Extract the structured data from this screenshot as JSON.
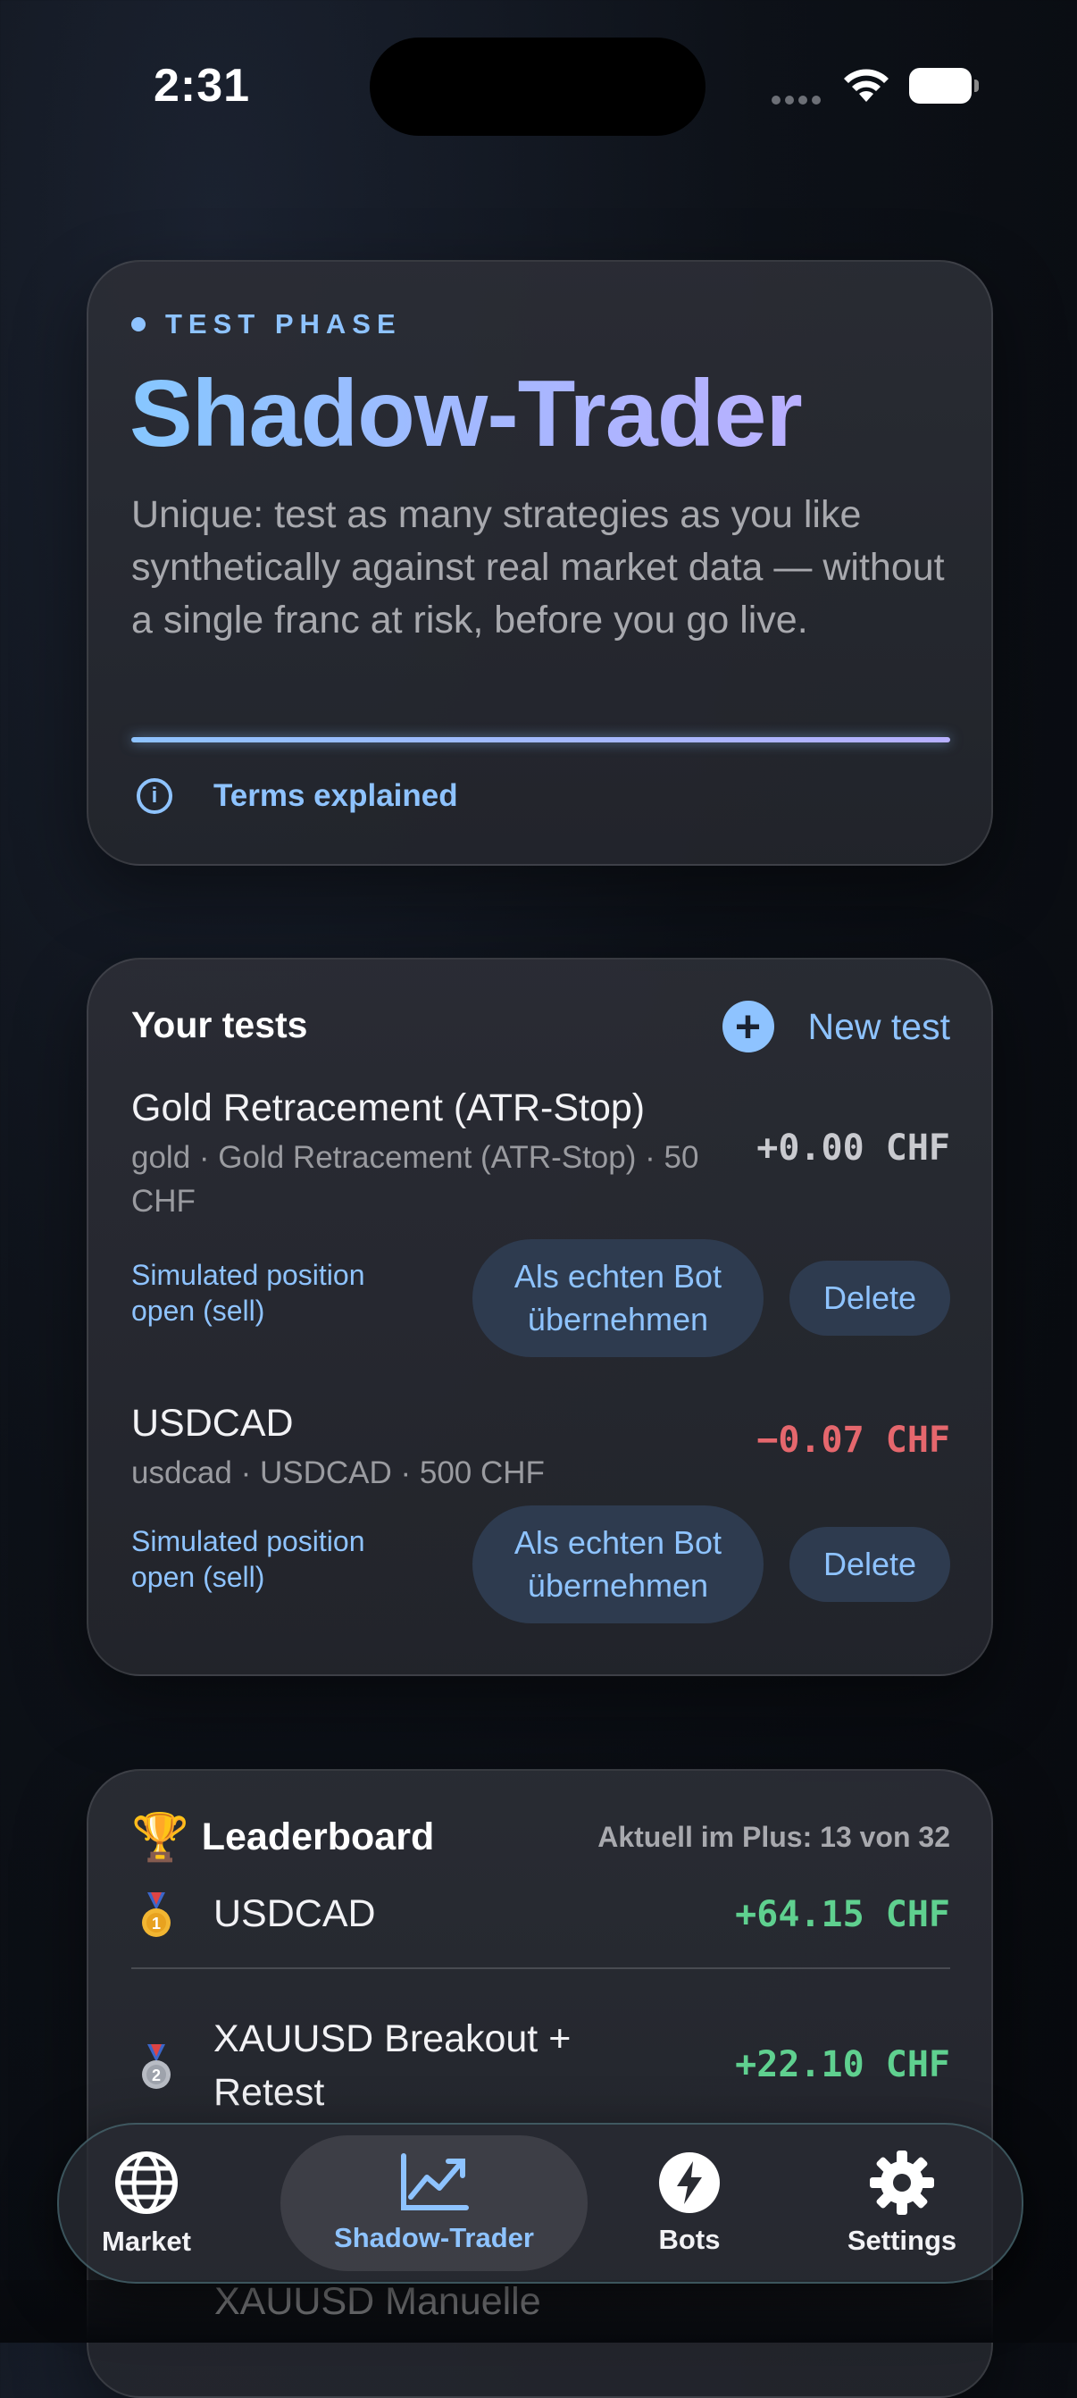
{
  "status_bar": {
    "time": "2:31"
  },
  "hero": {
    "badge": "TEST PHASE",
    "title": "Shadow-Trader",
    "description": "Unique: test as many strategies as you like synthetically against real market data — without a single franc at risk, before you go live.",
    "terms_link": "Terms explained"
  },
  "tests": {
    "heading": "Your tests",
    "new_test_label": "New test",
    "items": [
      {
        "name": "Gold Retracement (ATR-Stop)",
        "meta": "gold · Gold Retracement (ATR-Stop) · 50 CHF",
        "pnl": "+0.00 CHF",
        "pnl_color": "#c9cacf",
        "status": "Simulated position open (sell)",
        "adopt_label": "Als echten Bot übernehmen",
        "delete_label": "Delete"
      },
      {
        "name": "USDCAD",
        "meta": "usdcad · USDCAD · 500 CHF",
        "pnl": "−0.07 CHF",
        "pnl_color": "#e5676d",
        "status": "Simulated position open (sell)",
        "adopt_label": "Als echten Bot übernehmen",
        "delete_label": "Delete"
      }
    ]
  },
  "leaderboard": {
    "title": "Leaderboard",
    "summary": "Aktuell im Plus: 13 von 32",
    "rows": [
      {
        "medal": "gold-medal-icon",
        "name": "USDCAD",
        "value": "+64.15 CHF"
      },
      {
        "medal": "silver-medal-icon",
        "name": "XAUUSD Breakout + Retest",
        "value": "+22.10 CHF"
      }
    ],
    "partially_visible": "XAUUSD Manuelle"
  },
  "tabbar": {
    "items": [
      {
        "label": "Market",
        "icon": "globe-icon"
      },
      {
        "label": "Shadow-Trader",
        "icon": "chart-line-icon",
        "active": true
      },
      {
        "label": "Bots",
        "icon": "lightning-icon"
      },
      {
        "label": "Settings",
        "icon": "gear-icon"
      }
    ]
  },
  "colors": {
    "accent": "#8ec3ff",
    "positive": "#5fd08f",
    "negative": "#e5676d"
  }
}
